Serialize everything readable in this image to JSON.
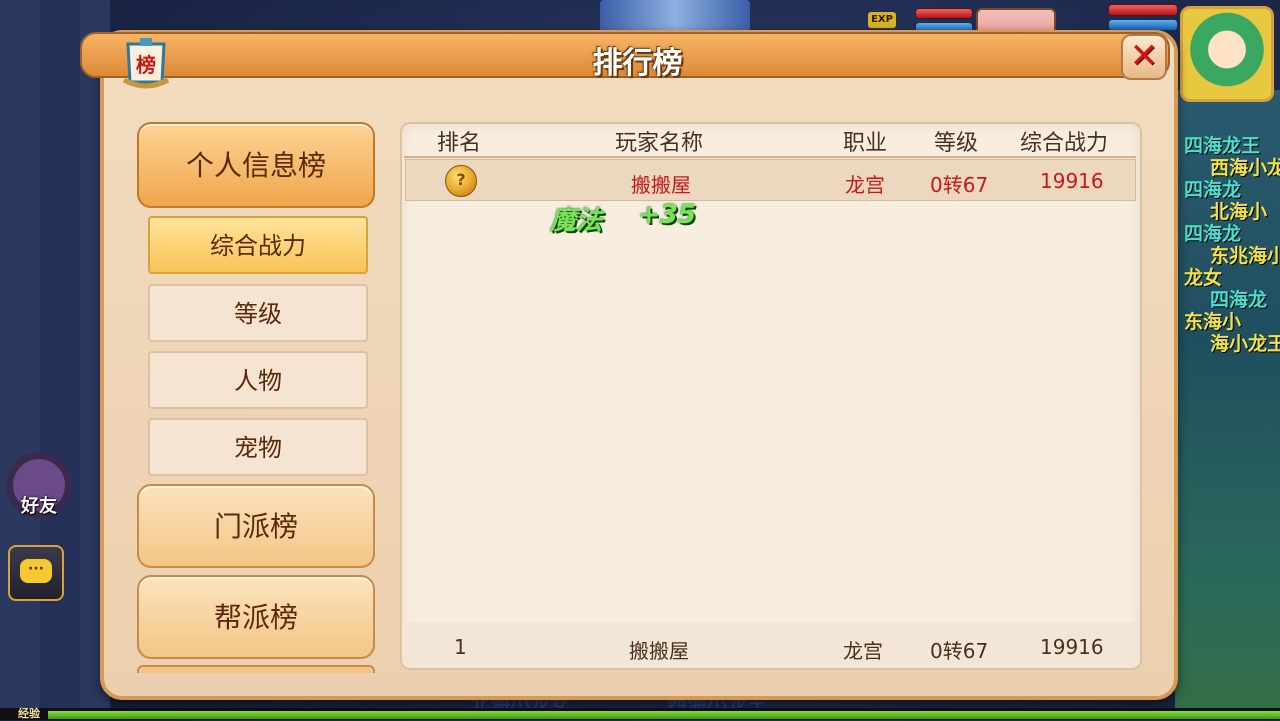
{
  "hud": {
    "exp_badge": "EXP",
    "friend_label": "好友",
    "chat_icon": "chat-bubble-icon",
    "exp_bar_label": "经验",
    "side_names": [
      {
        "text": "四海龙王",
        "color": "#48e0d0"
      },
      {
        "text": "西海小龙王",
        "color": "#f2e24a"
      },
      {
        "text": "四海龙",
        "color": "#48e0d0"
      },
      {
        "text": "北海小",
        "color": "#f2e24a"
      },
      {
        "text": "四海龙",
        "color": "#48e0d0"
      },
      {
        "text": "东兆海小",
        "color": "#f2e24a"
      },
      {
        "text": "龙女",
        "color": "#f2e24a"
      },
      {
        "text": "四海龙",
        "color": "#48e0d0"
      },
      {
        "text": "东海小",
        "color": "#f2e24a"
      },
      {
        "text": "海小龙王",
        "color": "#f2e24a"
      }
    ],
    "bottom_names": [
      "北海小龙女",
      "西海小龙王"
    ]
  },
  "panel": {
    "title": "排行榜",
    "badge_char": "榜",
    "close_symbol": "✕"
  },
  "nav": {
    "personal": "个人信息榜",
    "sub": [
      "综合战力",
      "等级",
      "人物",
      "宠物"
    ],
    "sect": "门派榜",
    "guild": "帮派榜"
  },
  "table": {
    "headers": {
      "rank": "排名",
      "name": "玩家名称",
      "class": "职业",
      "level": "等级",
      "power": "综合战力"
    },
    "rows": [
      {
        "rank_icon": "question-medal-icon",
        "rank_symbol": "?",
        "name": "搬搬屋",
        "class": "龙宫",
        "level": "0转67",
        "power": "19916"
      }
    ],
    "float": {
      "label": "魔法",
      "value": "+35"
    },
    "self_row": {
      "rank": "1",
      "name": "搬搬屋",
      "class": "龙宫",
      "level": "0转67",
      "power": "19916"
    }
  },
  "colors": {
    "accent": "#f0a64b",
    "row_text": "#c81818",
    "float_text": "#7be05a"
  }
}
